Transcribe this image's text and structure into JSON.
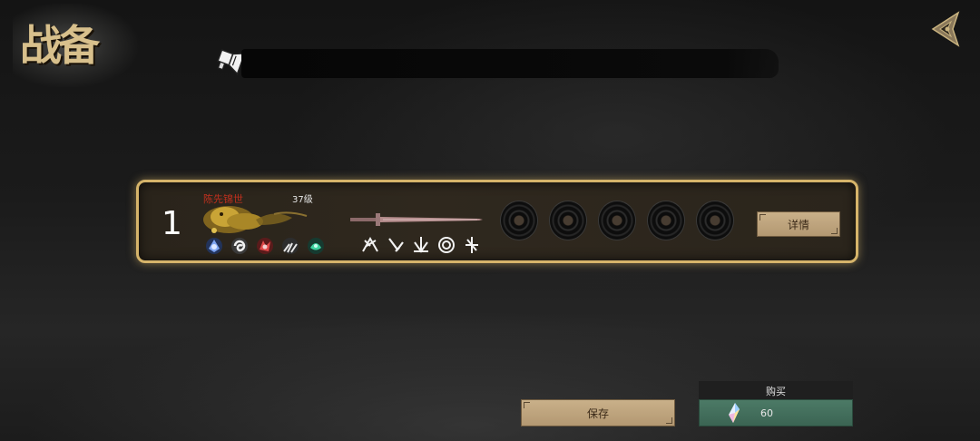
{
  "header": {
    "title": "战备"
  },
  "notice": {
    "text": ""
  },
  "card": {
    "rank": "1",
    "hero_name": "陈先锦世",
    "level": "37级",
    "skills": [
      "blue-crest-icon",
      "white-swirl-icon",
      "red-spirit-icon",
      "white-claw-icon",
      "green-beast-icon"
    ],
    "moves": [
      "slash-burst-icon",
      "dagger-strike-icon",
      "spike-burst-icon",
      "vortex-icon",
      "cross-blade-icon"
    ],
    "slots": 5,
    "detail_label": "详情"
  },
  "footer": {
    "save_label": "保存",
    "buy_title": "购买",
    "buy_price": "60"
  },
  "colors": {
    "accent_gold": "#d6b46a",
    "button_gold": "#c4aa82",
    "button_green": "#47725f",
    "name_red": "#c0301e"
  }
}
